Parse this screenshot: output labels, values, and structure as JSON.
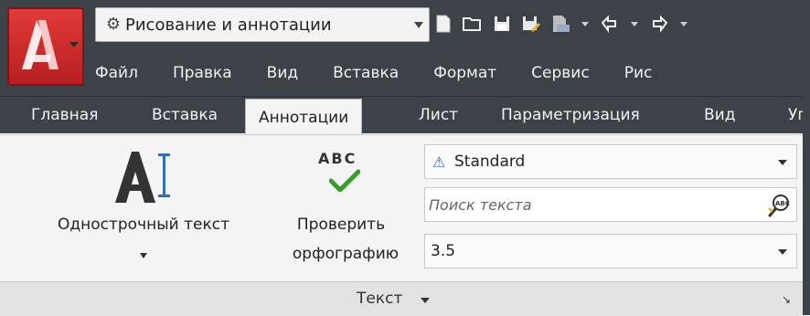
{
  "workspace": {
    "label": "Рисование и аннотации",
    "icon": "gear-icon"
  },
  "quick_access": [
    {
      "name": "new-icon"
    },
    {
      "name": "open-folder-icon"
    },
    {
      "name": "save-icon"
    },
    {
      "name": "save-as-icon"
    },
    {
      "name": "plot-icon"
    },
    {
      "name": "undo-icon"
    },
    {
      "name": "redo-icon"
    }
  ],
  "menu": [
    "Файл",
    "Правка",
    "Вид",
    "Вставка",
    "Формат",
    "Сервис",
    "Рис"
  ],
  "tabs": [
    "Главная",
    "Вставка",
    "Аннотации",
    "Лист",
    "Параметризация",
    "Вид",
    "Уп"
  ],
  "active_tab": "Аннотации",
  "panel": {
    "single_line_text": "Однострочный текст",
    "spell_abc": "ABC",
    "spell_check_line1": "Проверить",
    "spell_check_line2": "орфографию",
    "text_style": "Standard",
    "search_placeholder": "Поиск текста",
    "text_height": "3.5",
    "title": "Текст"
  },
  "colors": {
    "ribbon_dark": "#3d4249",
    "app_red": "#d32f2f",
    "check_green": "#3a9b2e",
    "panel_bg": "#f4f4f4"
  }
}
